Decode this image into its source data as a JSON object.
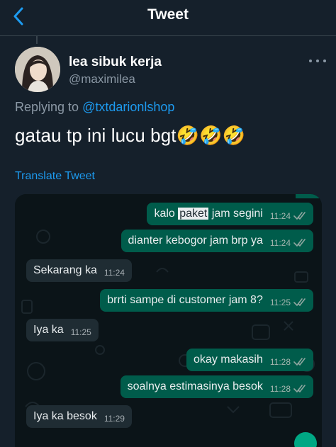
{
  "header": {
    "title": "Tweet"
  },
  "tweet": {
    "display_name": "lea sibuk kerja",
    "handle": "@maximilea",
    "replying_prefix": "Replying to",
    "replying_to": "@txtdarionlshop",
    "text": "gatau tp ini lucu bgt🤣🤣🤣",
    "translate_label": "Translate Tweet"
  },
  "chat": {
    "messages": [
      {
        "direction": "out",
        "text_before": "kalo ",
        "highlight": "paket",
        "text_after": " jam segini",
        "time": "11:24",
        "status": "read"
      },
      {
        "direction": "out",
        "text": "dianter kebogor jam brp ya",
        "time": "11:24",
        "status": "read"
      },
      {
        "direction": "in",
        "text": "Sekarang ka",
        "time": "11:24"
      },
      {
        "direction": "out",
        "text": "brrti sampe di customer jam 8?",
        "time": "11:25",
        "status": "read"
      },
      {
        "direction": "in",
        "text": "Iya ka",
        "time": "11:25"
      },
      {
        "direction": "out",
        "text": "okay makasih",
        "time": "11:28",
        "status": "read"
      },
      {
        "direction": "out",
        "text": "soalnya estimasinya besok",
        "time": "11:28",
        "status": "read"
      },
      {
        "direction": "in",
        "text": "Iya ka besok",
        "time": "11:29"
      }
    ]
  },
  "colors": {
    "background": "#15202b",
    "accent": "#1d9bf0",
    "outgoing_bubble": "#005c4b",
    "incoming_bubble": "#1f2c33"
  },
  "icons": {
    "back": "chevron-left-icon",
    "more": "more-horizontal-icon",
    "read_receipt": "double-check-icon"
  }
}
